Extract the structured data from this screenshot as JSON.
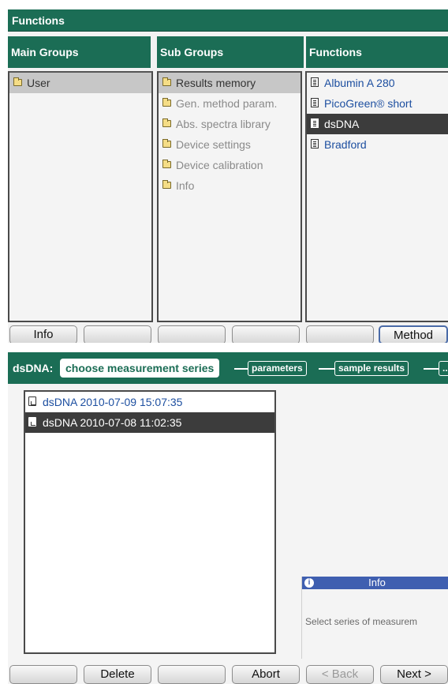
{
  "screen1": {
    "title": "Functions",
    "columns": {
      "main_groups": {
        "header": "Main Groups",
        "items": [
          {
            "label": "User",
            "icon": "folder-icon",
            "state": "selected"
          }
        ]
      },
      "sub_groups": {
        "header": "Sub Groups",
        "items": [
          {
            "label": "Results memory",
            "icon": "folder-icon",
            "state": "selected"
          },
          {
            "label": "Gen. method param.",
            "icon": "folder-icon",
            "state": "disabled"
          },
          {
            "label": "Abs. spectra library",
            "icon": "folder-icon",
            "state": "disabled"
          },
          {
            "label": "Device settings",
            "icon": "folder-icon",
            "state": "disabled"
          },
          {
            "label": "Device calibration",
            "icon": "folder-icon",
            "state": "disabled"
          },
          {
            "label": "Info",
            "icon": "folder-icon",
            "state": "disabled"
          }
        ]
      },
      "functions": {
        "header": "Functions",
        "items": [
          {
            "label": "Albumin A 280",
            "icon": "document-icon",
            "state": "normal"
          },
          {
            "label": "PicoGreen® short",
            "icon": "document-icon",
            "state": "normal"
          },
          {
            "label": "dsDNA",
            "icon": "document-icon",
            "state": "highlighted"
          },
          {
            "label": "Bradford",
            "icon": "document-icon",
            "state": "normal"
          }
        ]
      }
    },
    "softkeys": [
      "Info",
      "",
      "",
      "",
      "",
      "Method"
    ]
  },
  "screen2": {
    "wizard_label": "dsDNA:",
    "active_step": "choose measurement series",
    "steps": [
      "parameters",
      "sample results",
      "..."
    ],
    "series": [
      {
        "label": "dsDNA 2010-07-09 15:07:35",
        "state": "normal"
      },
      {
        "label": "dsDNA 2010-07-08 11:02:35",
        "state": "selected"
      }
    ],
    "info": {
      "title": "Info",
      "message": "Select series of measurem"
    },
    "softkeys": [
      "",
      "Delete",
      "",
      "Abort",
      "< Back",
      "Next >"
    ]
  },
  "colors": {
    "header_green": "#1b6d55",
    "selection_dark": "#3c3c3c",
    "selection_grey": "#c7c7c7",
    "link_blue": "#1d4fa0",
    "info_blue": "#3f5fb0"
  }
}
